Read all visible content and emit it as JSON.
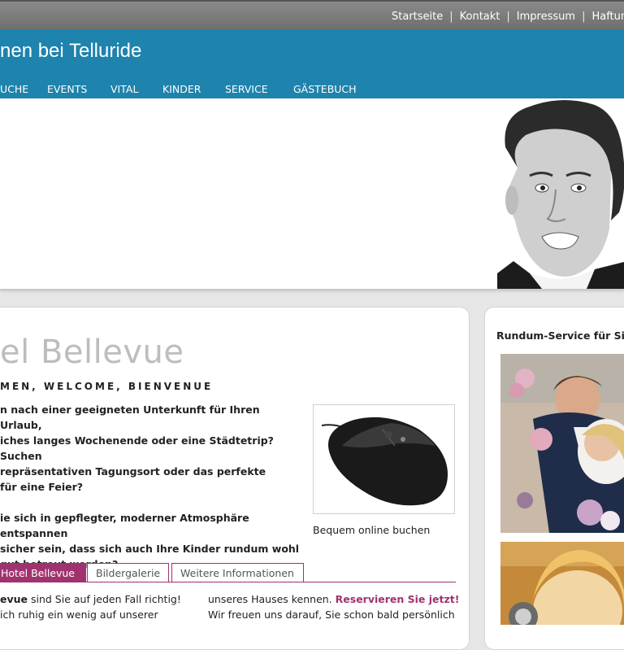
{
  "topnav": {
    "items": [
      "Startseite",
      "Kontakt",
      "Impressum",
      "Haftun"
    ],
    "separator": "|"
  },
  "header": {
    "title": "nen bei Telluride",
    "nav": [
      "UCHE",
      "EVENTS",
      "VITAL",
      "KINDER",
      "SERVICE",
      "GÄSTEBUCH"
    ],
    "color": "#1e83ad"
  },
  "main": {
    "heading": "el Bellevue",
    "welcome": "MEN, WELCOME, BIENVENUE",
    "intro_p1_lines": [
      "n nach einer geeigneten Unterkunft für Ihren Urlaub,",
      "iches langes Wochenende oder eine Städtetrip? Suchen",
      "repräsentativen Tagungsort oder das perfekte",
      "für eine Feier?"
    ],
    "intro_p2_lines": [
      "ie sich in gepflegter, moderner Atmosphäre entspannen",
      "sicher sein, dass sich auch Ihre Kinder rundum wohl",
      " gut betreut werden?"
    ],
    "product_caption": "Bequem online buchen",
    "tabs": [
      "Hotel Bellevue",
      "Bildergalerie",
      "Weitere Informationen"
    ],
    "col1_bold": "evue",
    "col1_line1_rest": " sind Sie auf jeden Fall richtig!",
    "col1_line2": "ich ruhig ein wenig auf unserer",
    "col2_line1": "unseres Hauses kennen. ",
    "col2_link": "Reservieren Sie jetzt!",
    "col2_line2": "Wir freuen uns darauf, Sie schon bald persönlich",
    "accent_color": "#a0336f"
  },
  "sidebar": {
    "title": "Rundum-Service für Sie"
  }
}
